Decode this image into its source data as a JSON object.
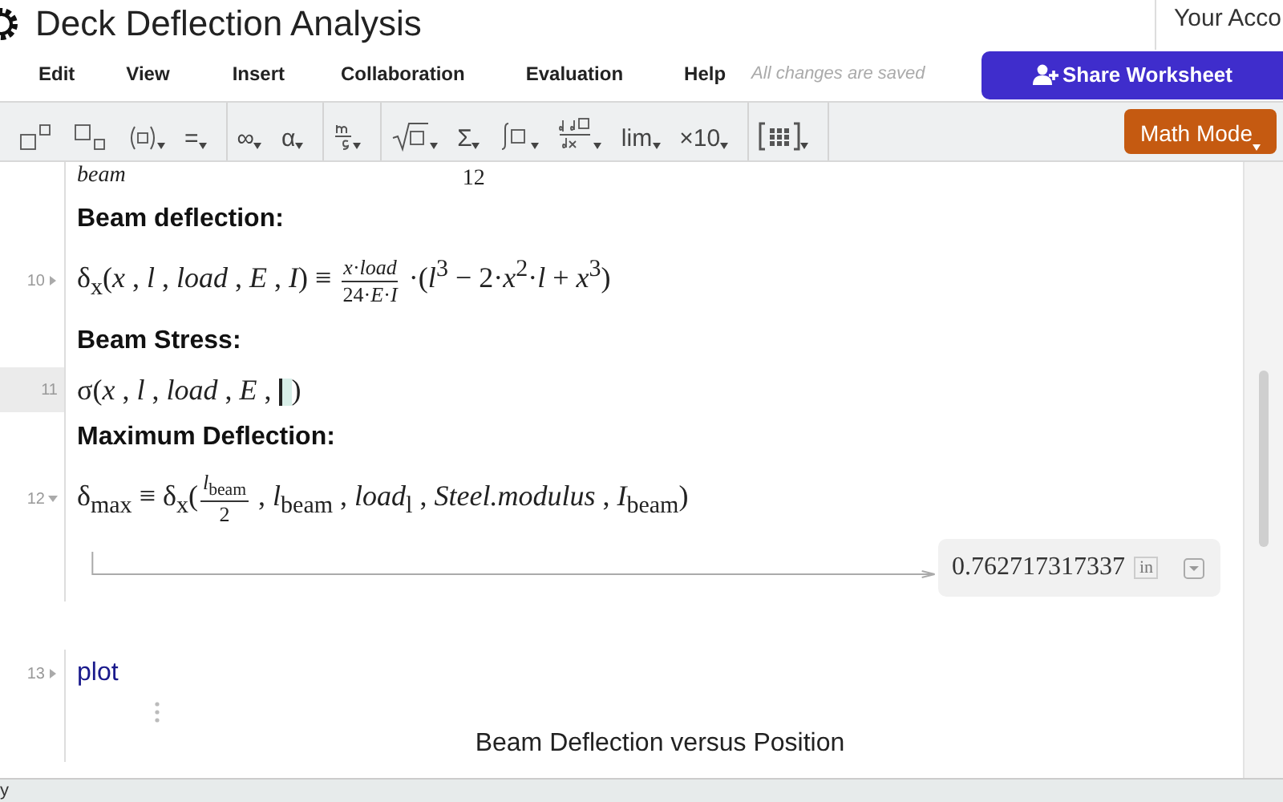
{
  "window": {
    "title": "Deck Deflection Analysis",
    "account": "Your Acco"
  },
  "menu": [
    "Edit",
    "View",
    "Insert",
    "Collaboration",
    "Evaluation",
    "Help"
  ],
  "save_status": "All changes are saved",
  "share_button": "Share Worksheet",
  "toolbar": [
    [
      {
        "kind": "superscript"
      },
      {
        "kind": "subscript"
      },
      {
        "kind": "paren"
      },
      {
        "kind": "text",
        "label": "="
      }
    ],
    [
      {
        "kind": "text",
        "label": "∞"
      },
      {
        "kind": "text",
        "label": "α"
      }
    ],
    [
      {
        "kind": "units"
      }
    ],
    [
      {
        "kind": "sqrt"
      },
      {
        "kind": "text",
        "label": "Σ"
      },
      {
        "kind": "integral"
      },
      {
        "kind": "derivative"
      },
      {
        "kind": "text",
        "label": "lim"
      },
      {
        "kind": "text",
        "label": "×10"
      }
    ],
    [
      {
        "kind": "matrix"
      }
    ]
  ],
  "mode_button": "Math Mode",
  "worksheet": [
    {
      "kind": "cut",
      "left": "beam",
      "denominator": "12"
    },
    {
      "kind": "heading",
      "text": "Beam deflection:"
    },
    {
      "kind": "math",
      "number": "10",
      "expanded": false,
      "selected": false,
      "parts": [
        {
          "kind": "text",
          "s": "δ$_{x}$(*x* , *l* , *load* , *E* , *I*) ≡ "
        },
        {
          "kind": "frac",
          "num": "*x*·*load*",
          "den": "24·*E*·*I*"
        },
        {
          "kind": "text",
          "s": " ·(*l*$^{3}$ − 2·*x*$^{2}$·*l* + *x*$^{3}$)"
        }
      ]
    },
    {
      "kind": "heading",
      "text": "Beam Stress:"
    },
    {
      "kind": "math",
      "number": "11",
      "selected": true,
      "parts": [
        {
          "kind": "text",
          "s": "σ(*x* , *l* , *load* , *E* , "
        },
        {
          "kind": "caret"
        },
        {
          "kind": "text",
          "s": ")"
        }
      ]
    },
    {
      "kind": "heading",
      "text": "Maximum Deflection:"
    },
    {
      "kind": "math",
      "number": "12",
      "expanded": true,
      "selected": false,
      "parts": [
        {
          "kind": "text",
          "s": "δ$_{max}$ ≡ δ$_{x}$("
        },
        {
          "kind": "frac",
          "num": "*l*$_{beam}$",
          "den": "2"
        },
        {
          "kind": "text",
          "s": " , *l*$_{beam}$ , *load*$_{l}$ , *Steel.modulus* , *I*$_{beam}$)"
        }
      ],
      "result": {
        "value": "0.762717317337",
        "unit": "in"
      }
    },
    {
      "kind": "plot",
      "number": "13",
      "expanded": false,
      "selected": false,
      "keyword": "plot",
      "title": "Beam Deflection versus Position"
    }
  ],
  "status_bar": "y"
}
